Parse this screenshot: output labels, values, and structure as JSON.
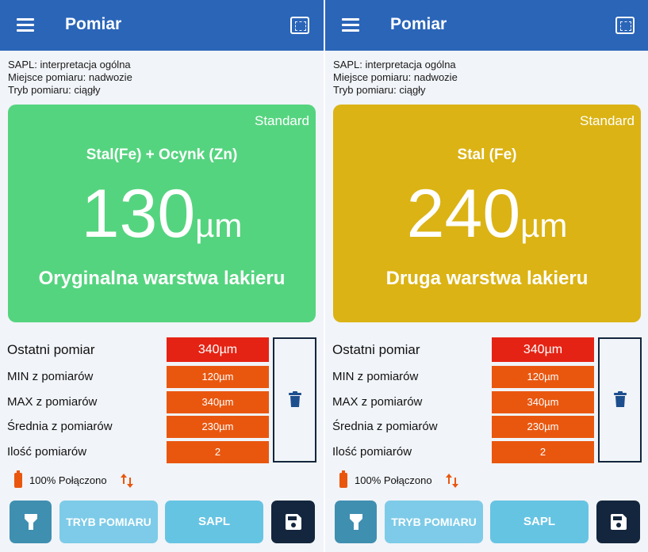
{
  "colors": {
    "appbar": "#2a65b8",
    "card_green": "#55d47f",
    "card_yellow": "#dbb314",
    "last_red": "#e52314",
    "stat_orange": "#e9570f",
    "dark_navy": "#13263d"
  },
  "icons": {
    "menu": "hamburger-icon",
    "fullscreen": "fullscreen-icon",
    "trash": "trash-icon",
    "battery": "battery-icon",
    "connection": "up-down-arrows-icon",
    "torch": "flashlight-icon",
    "save": "floppy-disk-icon"
  },
  "panels": [
    {
      "app_title": "Pomiar",
      "info_lines": [
        "SAPL: interpretacja ogólna",
        "Miejsce pomiaru: nadwozie",
        "Tryb pomiaru: ciągły"
      ],
      "card": {
        "color": "#55d47f",
        "standard": "Standard",
        "material": "Stal(Fe) + Ocynk (Zn)",
        "value": "130",
        "unit": "µm",
        "layer": "Oryginalna warstwa lakieru"
      },
      "stats": [
        {
          "label": "Ostatni pomiar",
          "value": "340µm"
        },
        {
          "label": "MIN z pomiarów",
          "value": "120µm"
        },
        {
          "label": "MAX z pomiarów",
          "value": "340µm"
        },
        {
          "label": "Średnia z pomiarów",
          "value": "230µm"
        },
        {
          "label": "Ilość pomiarów",
          "value": "2"
        }
      ],
      "status": "100% Połączono",
      "buttons": {
        "mode": "TRYB POMIARU",
        "sapl": "SAPL"
      }
    },
    {
      "app_title": "Pomiar",
      "info_lines": [
        "SAPL: interpretacja ogólna",
        "Miejsce pomiaru: nadwozie",
        "Tryb pomiaru: ciągły"
      ],
      "card": {
        "color": "#dbb314",
        "standard": "Standard",
        "material": "Stal (Fe)",
        "value": "240",
        "unit": "µm",
        "layer": "Druga warstwa lakieru"
      },
      "stats": [
        {
          "label": "Ostatni pomiar",
          "value": "340µm"
        },
        {
          "label": "MIN z pomiarów",
          "value": "120µm"
        },
        {
          "label": "MAX z pomiarów",
          "value": "340µm"
        },
        {
          "label": "Średnia z pomiarów",
          "value": "230µm"
        },
        {
          "label": "Ilość pomiarów",
          "value": "2"
        }
      ],
      "status": "100% Połączono",
      "buttons": {
        "mode": "TRYB POMIARU",
        "sapl": "SAPL"
      }
    }
  ]
}
